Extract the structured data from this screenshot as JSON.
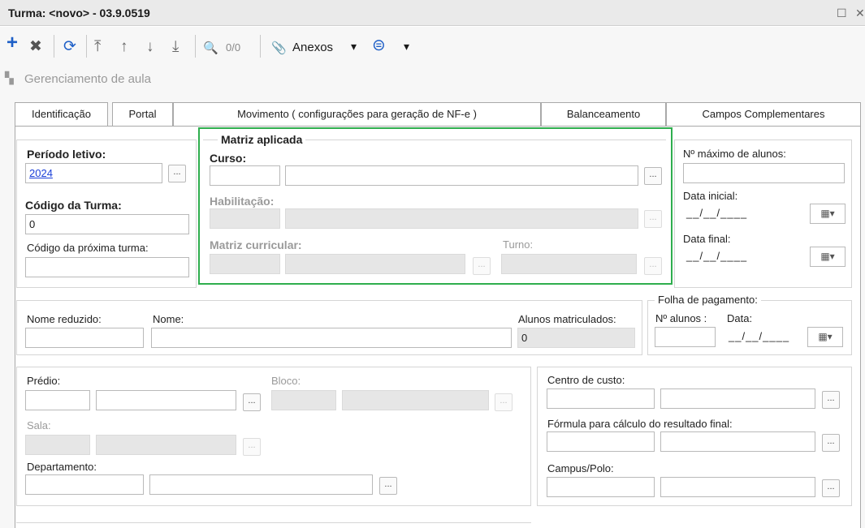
{
  "window": {
    "title": "Turma: <novo> - 03.9.0519",
    "restore_glyph": "☐",
    "close_glyph": "✕"
  },
  "toolbar": {
    "add_icon": "+",
    "delete_icon": "✖",
    "refresh_icon": "⟳",
    "first_icon": "⤒",
    "up_icon": "↑",
    "down_icon": "↓",
    "last_icon": "⤓",
    "search_icon": "🔍",
    "counter": "0/0",
    "attachments_icon": "📎",
    "attachments_label": "Anexos",
    "dropdown_glyph": "▾",
    "more_icon": "⊜"
  },
  "breadcrumb": {
    "icon": "▚",
    "label": "Gerenciamento de aula"
  },
  "tabs": [
    {
      "label": "Identificação"
    },
    {
      "label": "Portal"
    },
    {
      "label": "Movimento ( configurações para geração de NF-e )"
    },
    {
      "label": "Balanceamento"
    },
    {
      "label": "Campos Complementares"
    }
  ],
  "form": {
    "periodo_label": "Período letivo:",
    "periodo_value": "2024",
    "codigo_label": "Código da Turma:",
    "codigo_value": "0",
    "proxima_label": "Código da próxima turma:",
    "matriz_legend": "Matriz aplicada",
    "curso_label": "Curso:",
    "habilitacao_label": "Habilitação:",
    "matriz_label": "Matriz curricular:",
    "turno_label": "Turno:",
    "max_alunos_label": "Nº máximo de alunos:",
    "data_inicial_label": "Data inicial:",
    "data_final_label": "Data final:",
    "date_mask": "__/__/____",
    "calendar_glyph": "▦▾",
    "lookup_glyph": "...",
    "nome_reduzido_label": "Nome reduzido:",
    "nome_label": "Nome:",
    "alunos_matriculados_label": "Alunos matriculados:",
    "alunos_matriculados_value": "0",
    "folha_legend": "Folha de pagamento:",
    "n_alunos_label": "Nº alunos :",
    "data_label": "Data:",
    "predio_label": "Prédio:",
    "bloco_label": "Bloco:",
    "sala_label": "Sala:",
    "departamento_label": "Departamento:",
    "centro_custo_label": "Centro de custo:",
    "formula_label": "Fórmula para cálculo do resultado final:",
    "campus_label": "Campus/Polo:"
  },
  "colors": {
    "highlight": "#2fae4e",
    "link": "#1a3fd8"
  }
}
